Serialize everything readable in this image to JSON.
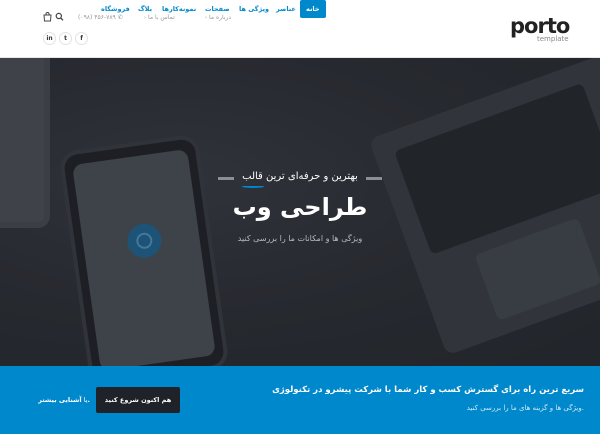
{
  "header": {
    "logo": {
      "word": "porto",
      "sub": "template"
    },
    "topbar": {
      "about": "درباره ما",
      "contact": "تماس با ما",
      "phone": "(۰۹۸) ۴۵۶-۷۸۹"
    },
    "nav": [
      "خانه",
      "عناصر",
      "ویژگی ها",
      "صفحات",
      "نمونه‌کارها",
      "بلاگ",
      "فروشگاه"
    ],
    "social": [
      "in",
      "t",
      "f"
    ]
  },
  "hero": {
    "subtitle": "بهترین و حرفه‌ای ترین قالب",
    "title": "طراحی وب",
    "description": "ویژگی ها و امکانات ما را بررسی کنید"
  },
  "cta": {
    "title": "سریع ترین راه برای گسترش کسب و کار شما با شرکت پیشرو در تکنولوژی",
    "text": "ویژگی ها و گزینه های ما را بررسی کنید.",
    "button": "هم اکنون شروع کنید",
    "or": "یا",
    "learn_more": "آشنایی بیشتر."
  },
  "colors": {
    "accent": "#0088cc",
    "dark": "#2a2d33",
    "button": "#1f2329"
  }
}
